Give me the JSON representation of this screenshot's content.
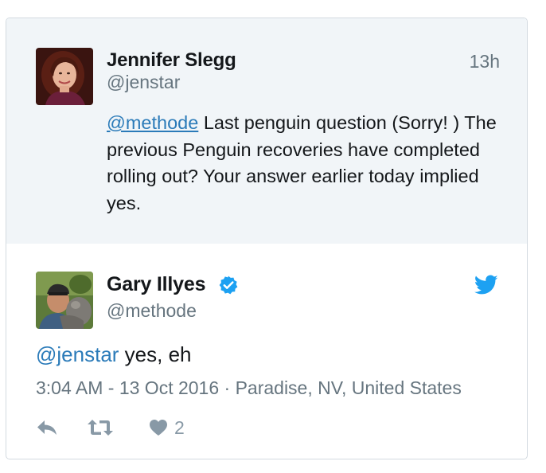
{
  "parent_tweet": {
    "author_name": "Jennifer Slegg",
    "handle": "@jenstar",
    "timestamp": "13h",
    "mention": "@methode",
    "text": " Last penguin question (Sorry! ) The previous Penguin recoveries have completed rolling out? Your answer earlier today implied yes."
  },
  "reply_tweet": {
    "author_name": "Gary Illyes",
    "verified": true,
    "handle": "@methode",
    "mention": "@jenstar",
    "text": " yes, eh",
    "meta": "3:04 AM - 13 Oct 2016 · Paradise, NV, United States",
    "like_count": "2"
  },
  "colors": {
    "link": "#2b7bb9",
    "verified": "#1da1f2",
    "twitter_bird": "#1da1f2",
    "parent_background": "#f1f5f8",
    "secondary_text": "#66757f"
  },
  "icons": {
    "brand": "twitter-bird-icon",
    "verified": "verified-badge-icon",
    "reply": "reply-icon",
    "retweet": "retweet-icon",
    "like": "heart-icon"
  }
}
